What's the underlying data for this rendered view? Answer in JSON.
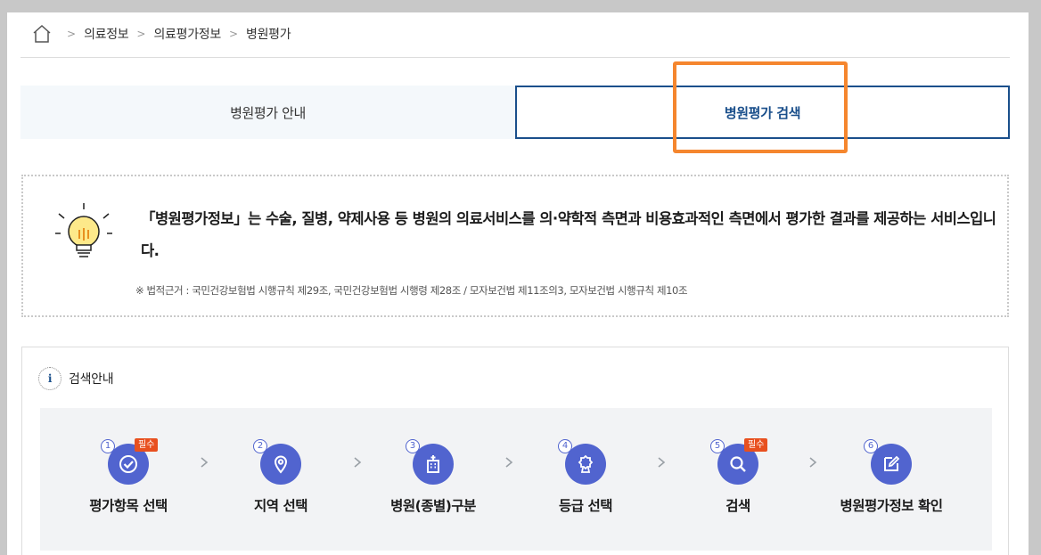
{
  "breadcrumb": {
    "items": [
      "의료정보",
      "의료평가정보",
      "병원평가"
    ]
  },
  "tabs": [
    {
      "label": "병원평가 안내",
      "active": false
    },
    {
      "label": "병원평가 검색",
      "active": true
    }
  ],
  "info": {
    "main_text": "「병원평가정보」는 수술, 질병, 약제사용 등 병원의 의료서비스를 의·약학적 측면과 비용효과적인 측면에서 평가한 결과를 제공하는 서비스입니다.",
    "note": "※ 법적근거 : 국민건강보험법 시행규칙 제29조, 국민건강보험법 시행령 제28조 / 모자보건법 제11조의3, 모자보건법 시행규칙 제10조"
  },
  "guide": {
    "title": "검색안내",
    "steps": [
      {
        "num": "1",
        "label": "평가항목 선택",
        "badge": "필수",
        "icon": "check-circle-icon"
      },
      {
        "num": "2",
        "label": "지역 선택",
        "badge": "",
        "icon": "location-pin-icon"
      },
      {
        "num": "3",
        "label": "병원(종별)구분",
        "badge": "",
        "icon": "hospital-building-icon"
      },
      {
        "num": "4",
        "label": "등급 선택",
        "badge": "",
        "icon": "award-icon"
      },
      {
        "num": "5",
        "label": "검색",
        "badge": "필수",
        "icon": "search-icon"
      },
      {
        "num": "6",
        "label": "병원평가정보 확인",
        "badge": "",
        "icon": "edit-icon"
      }
    ]
  },
  "colors": {
    "accent": "#1a4f8b",
    "step_circle": "#5164cf",
    "badge": "#e8501f",
    "highlight": "#f5862e"
  }
}
